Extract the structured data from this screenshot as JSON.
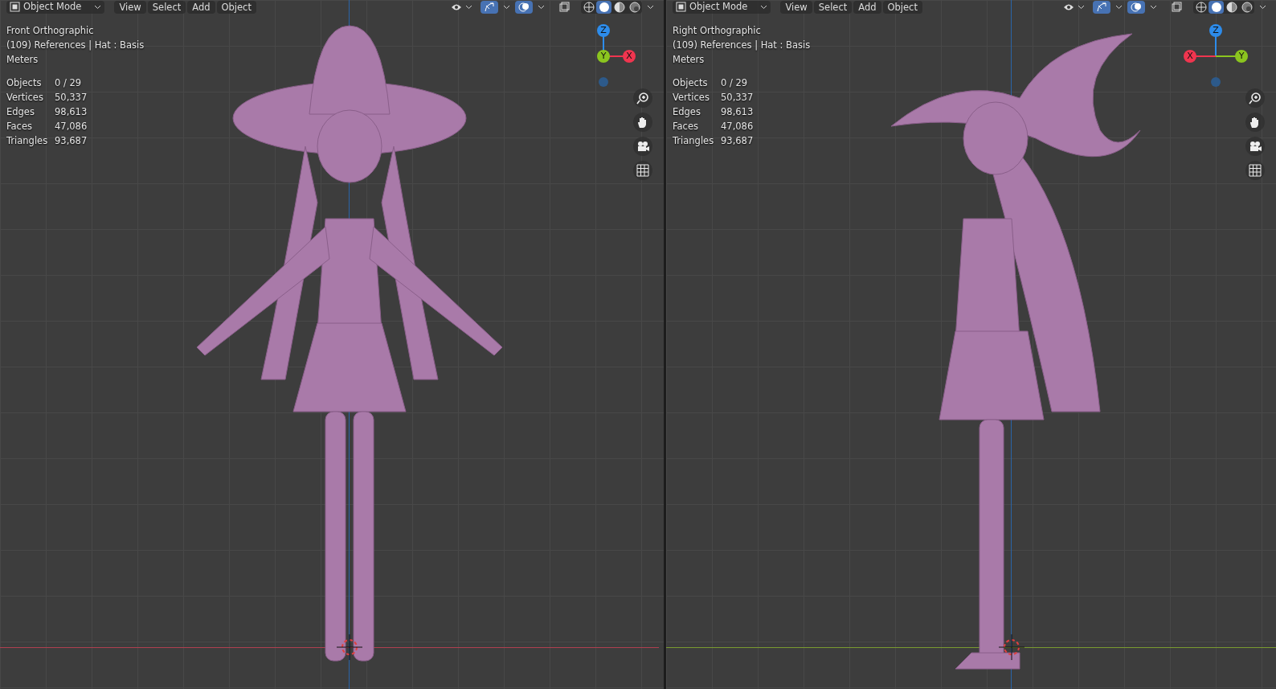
{
  "viewports": [
    {
      "kind": "front",
      "header": {
        "mode": "Object Mode",
        "menus": [
          "View",
          "Select",
          "Add",
          "Object"
        ],
        "gizmo_on": true,
        "overlays_on": true,
        "shading": [
          {
            "selected": false
          },
          {
            "selected": true
          },
          {
            "selected": false
          },
          {
            "selected": false
          }
        ]
      },
      "overlay": {
        "view_name": "Front Orthographic",
        "collection": "(109) References | Hat : Basis",
        "units": "Meters",
        "stats": [
          {
            "label": "Objects",
            "value": "0 / 29"
          },
          {
            "label": "Vertices",
            "value": "50,337"
          },
          {
            "label": "Edges",
            "value": "98,613"
          },
          {
            "label": "Faces",
            "value": "47,086"
          },
          {
            "label": "Triangles",
            "value": "93,687"
          }
        ]
      },
      "gizmo": [
        {
          "label": "Z",
          "kind": "top",
          "color": "#2d8ceb"
        },
        {
          "label": "Y",
          "kind": "center",
          "color": "#8bc51f"
        },
        {
          "label": "X",
          "kind": "right",
          "color": "#f0354f"
        }
      ]
    },
    {
      "kind": "side",
      "header": {
        "mode": "Object Mode",
        "menus": [
          "View",
          "Select",
          "Add",
          "Object"
        ],
        "gizmo_on": true,
        "overlays_on": true,
        "shading": [
          {
            "selected": false
          },
          {
            "selected": true
          },
          {
            "selected": false
          },
          {
            "selected": false
          }
        ]
      },
      "overlay": {
        "view_name": "Right Orthographic",
        "collection": "(109) References | Hat : Basis",
        "units": "Meters",
        "stats": [
          {
            "label": "Objects",
            "value": "0 / 29"
          },
          {
            "label": "Vertices",
            "value": "50,337"
          },
          {
            "label": "Edges",
            "value": "98,613"
          },
          {
            "label": "Faces",
            "value": "47,086"
          },
          {
            "label": "Triangles",
            "value": "93,687"
          }
        ]
      },
      "gizmo": [
        {
          "label": "Z",
          "kind": "top",
          "color": "#2d8ceb"
        },
        {
          "label": "X",
          "kind": "left",
          "color": "#f0354f"
        },
        {
          "label": "Y",
          "kind": "right",
          "color": "#8bc51f"
        }
      ]
    }
  ]
}
